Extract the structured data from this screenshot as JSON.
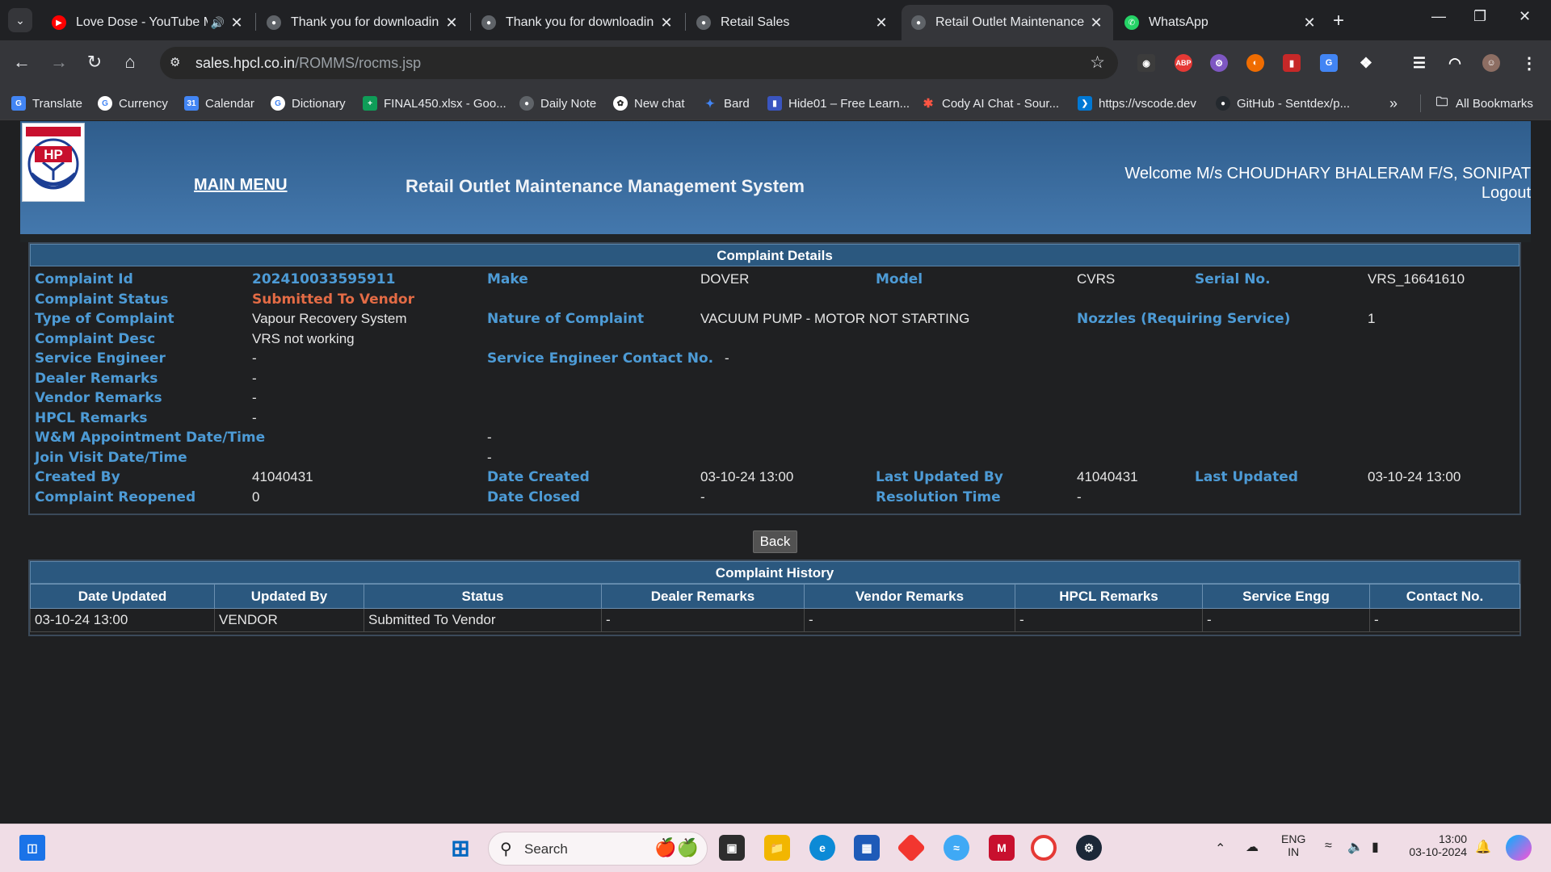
{
  "browser": {
    "tabs": [
      {
        "title": "Love Dose - YouTube M",
        "icon": "youtube-icon",
        "active": false
      },
      {
        "title": "Thank you for downloading",
        "icon": "globe-icon",
        "active": false
      },
      {
        "title": "Thank you for downloading",
        "icon": "globe-icon",
        "active": false
      },
      {
        "title": "Retail Sales",
        "icon": "globe-icon",
        "active": false
      },
      {
        "title": "Retail Outlet Maintenance",
        "icon": "globe-icon",
        "active": true
      },
      {
        "title": "WhatsApp",
        "icon": "whatsapp-icon",
        "active": false
      }
    ],
    "url_host": "sales.hpcl.co.in",
    "url_path": "/ROMMS/rocms.jsp",
    "bookmarks": [
      {
        "label": "Translate",
        "icon": "translate-icon",
        "color": "#4285f4"
      },
      {
        "label": "Currency",
        "icon": "google-icon",
        "color": "#ffffff"
      },
      {
        "label": "Calendar",
        "icon": "calendar-icon",
        "color": "#4285f4"
      },
      {
        "label": "Dictionary",
        "icon": "google-icon",
        "color": "#ffffff"
      },
      {
        "label": "FINAL450.xlsx - Goo...",
        "icon": "sheets-icon",
        "color": "#0f9d58"
      },
      {
        "label": "Daily Note",
        "icon": "note-icon",
        "color": "#5f6368"
      },
      {
        "label": "New chat",
        "icon": "chatgpt-icon",
        "color": "#ffffff"
      },
      {
        "label": "Bard",
        "icon": "bard-icon",
        "color": "#4285f4"
      },
      {
        "label": "Hide01 – Free Learn...",
        "icon": "bookmark-icon",
        "color": "#3a55c0"
      },
      {
        "label": "Cody AI Chat - Sour...",
        "icon": "cody-icon",
        "color": "#ff5543"
      },
      {
        "label": "https://vscode.dev",
        "icon": "vscode-icon",
        "color": "#0078d4"
      },
      {
        "label": "GitHub - Sentdex/p...",
        "icon": "github-icon",
        "color": "#24292e"
      }
    ],
    "all_bookmarks": "All Bookmarks"
  },
  "header": {
    "main_menu": "MAIN MENU",
    "title": "Retail Outlet Maintenance Management System",
    "welcome": "Welcome M/s CHOUDHARY BHALERAM F/S, SONIPAT",
    "logout": "Logout"
  },
  "complaint": {
    "panel_title": "Complaint Details",
    "complaint_id_label": "Complaint Id",
    "complaint_id": "202410033595911",
    "make_label": "Make",
    "make": "DOVER",
    "model_label": "Model",
    "model": "CVRS",
    "serial_label": "Serial No.",
    "serial": "VRS_16641610",
    "status_label": "Complaint Status",
    "status": "Submitted To Vendor",
    "type_label": "Type of Complaint",
    "type": "Vapour Recovery System",
    "nature_label": "Nature of Complaint",
    "nature": "VACUUM PUMP - MOTOR NOT STARTING",
    "nozzles_label": "Nozzles (Requiring Service)",
    "nozzles": "1",
    "desc_label": "Complaint Desc",
    "desc": "VRS not working",
    "engineer_label": "Service Engineer",
    "engineer": "-",
    "engineer_contact_label": "Service Engineer Contact No.",
    "engineer_contact": "-",
    "dealer_remarks_label": "Dealer Remarks",
    "dealer_remarks": "-",
    "vendor_remarks_label": "Vendor Remarks",
    "vendor_remarks": "-",
    "hpcl_remarks_label": "HPCL Remarks",
    "hpcl_remarks": "-",
    "wm_label": "W&M Appointment Date/Time",
    "wm": "-",
    "join_label": "Join Visit Date/Time",
    "join": "-",
    "created_by_label": "Created By",
    "created_by": "41040431",
    "date_created_label": "Date Created",
    "date_created": "03-10-24 13:00",
    "last_updated_by_label": "Last Updated By",
    "last_updated_by": "41040431",
    "last_updated_label": "Last Updated",
    "last_updated": "03-10-24 13:00",
    "reopened_label": "Complaint Reopened",
    "reopened": "0",
    "date_closed_label": "Date Closed",
    "date_closed": "-",
    "resolution_label": "Resolution Time",
    "resolution": "-",
    "back": "Back"
  },
  "history": {
    "panel_title": "Complaint History",
    "columns": [
      "Date Updated",
      "Updated By",
      "Status",
      "Dealer Remarks",
      "Vendor Remarks",
      "HPCL Remarks",
      "Service Engg",
      "Contact No."
    ],
    "rows": [
      [
        "03-10-24 13:00",
        "VENDOR",
        "Submitted To Vendor",
        "-",
        "-",
        "-",
        "-",
        "-"
      ]
    ]
  },
  "taskbar": {
    "search_placeholder": "Search",
    "lang_top": "ENG",
    "lang_bottom": "IN",
    "time": "13:00",
    "date": "03-10-2024"
  }
}
